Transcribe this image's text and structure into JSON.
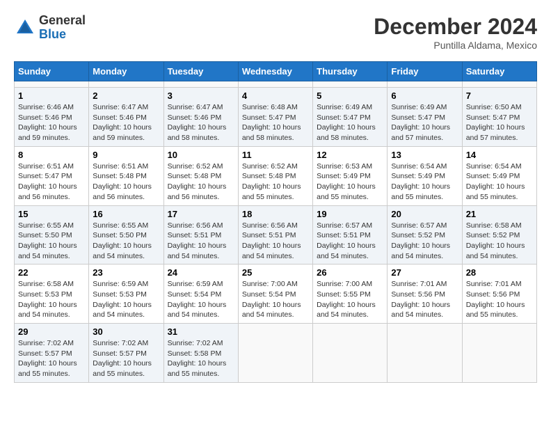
{
  "header": {
    "logo_general": "General",
    "logo_blue": "Blue",
    "month_title": "December 2024",
    "subtitle": "Puntilla Aldama, Mexico"
  },
  "calendar": {
    "columns": [
      "Sunday",
      "Monday",
      "Tuesday",
      "Wednesday",
      "Thursday",
      "Friday",
      "Saturday"
    ],
    "weeks": [
      [
        null,
        null,
        null,
        null,
        null,
        null,
        null
      ],
      [
        {
          "day": 1,
          "info": "Sunrise: 6:46 AM\nSunset: 5:46 PM\nDaylight: 10 hours\nand 59 minutes."
        },
        {
          "day": 2,
          "info": "Sunrise: 6:47 AM\nSunset: 5:46 PM\nDaylight: 10 hours\nand 59 minutes."
        },
        {
          "day": 3,
          "info": "Sunrise: 6:47 AM\nSunset: 5:46 PM\nDaylight: 10 hours\nand 58 minutes."
        },
        {
          "day": 4,
          "info": "Sunrise: 6:48 AM\nSunset: 5:47 PM\nDaylight: 10 hours\nand 58 minutes."
        },
        {
          "day": 5,
          "info": "Sunrise: 6:49 AM\nSunset: 5:47 PM\nDaylight: 10 hours\nand 58 minutes."
        },
        {
          "day": 6,
          "info": "Sunrise: 6:49 AM\nSunset: 5:47 PM\nDaylight: 10 hours\nand 57 minutes."
        },
        {
          "day": 7,
          "info": "Sunrise: 6:50 AM\nSunset: 5:47 PM\nDaylight: 10 hours\nand 57 minutes."
        }
      ],
      [
        {
          "day": 8,
          "info": "Sunrise: 6:51 AM\nSunset: 5:47 PM\nDaylight: 10 hours\nand 56 minutes."
        },
        {
          "day": 9,
          "info": "Sunrise: 6:51 AM\nSunset: 5:48 PM\nDaylight: 10 hours\nand 56 minutes."
        },
        {
          "day": 10,
          "info": "Sunrise: 6:52 AM\nSunset: 5:48 PM\nDaylight: 10 hours\nand 56 minutes."
        },
        {
          "day": 11,
          "info": "Sunrise: 6:52 AM\nSunset: 5:48 PM\nDaylight: 10 hours\nand 55 minutes."
        },
        {
          "day": 12,
          "info": "Sunrise: 6:53 AM\nSunset: 5:49 PM\nDaylight: 10 hours\nand 55 minutes."
        },
        {
          "day": 13,
          "info": "Sunrise: 6:54 AM\nSunset: 5:49 PM\nDaylight: 10 hours\nand 55 minutes."
        },
        {
          "day": 14,
          "info": "Sunrise: 6:54 AM\nSunset: 5:49 PM\nDaylight: 10 hours\nand 55 minutes."
        }
      ],
      [
        {
          "day": 15,
          "info": "Sunrise: 6:55 AM\nSunset: 5:50 PM\nDaylight: 10 hours\nand 54 minutes."
        },
        {
          "day": 16,
          "info": "Sunrise: 6:55 AM\nSunset: 5:50 PM\nDaylight: 10 hours\nand 54 minutes."
        },
        {
          "day": 17,
          "info": "Sunrise: 6:56 AM\nSunset: 5:51 PM\nDaylight: 10 hours\nand 54 minutes."
        },
        {
          "day": 18,
          "info": "Sunrise: 6:56 AM\nSunset: 5:51 PM\nDaylight: 10 hours\nand 54 minutes."
        },
        {
          "day": 19,
          "info": "Sunrise: 6:57 AM\nSunset: 5:51 PM\nDaylight: 10 hours\nand 54 minutes."
        },
        {
          "day": 20,
          "info": "Sunrise: 6:57 AM\nSunset: 5:52 PM\nDaylight: 10 hours\nand 54 minutes."
        },
        {
          "day": 21,
          "info": "Sunrise: 6:58 AM\nSunset: 5:52 PM\nDaylight: 10 hours\nand 54 minutes."
        }
      ],
      [
        {
          "day": 22,
          "info": "Sunrise: 6:58 AM\nSunset: 5:53 PM\nDaylight: 10 hours\nand 54 minutes."
        },
        {
          "day": 23,
          "info": "Sunrise: 6:59 AM\nSunset: 5:53 PM\nDaylight: 10 hours\nand 54 minutes."
        },
        {
          "day": 24,
          "info": "Sunrise: 6:59 AM\nSunset: 5:54 PM\nDaylight: 10 hours\nand 54 minutes."
        },
        {
          "day": 25,
          "info": "Sunrise: 7:00 AM\nSunset: 5:54 PM\nDaylight: 10 hours\nand 54 minutes."
        },
        {
          "day": 26,
          "info": "Sunrise: 7:00 AM\nSunset: 5:55 PM\nDaylight: 10 hours\nand 54 minutes."
        },
        {
          "day": 27,
          "info": "Sunrise: 7:01 AM\nSunset: 5:56 PM\nDaylight: 10 hours\nand 54 minutes."
        },
        {
          "day": 28,
          "info": "Sunrise: 7:01 AM\nSunset: 5:56 PM\nDaylight: 10 hours\nand 55 minutes."
        }
      ],
      [
        {
          "day": 29,
          "info": "Sunrise: 7:02 AM\nSunset: 5:57 PM\nDaylight: 10 hours\nand 55 minutes."
        },
        {
          "day": 30,
          "info": "Sunrise: 7:02 AM\nSunset: 5:57 PM\nDaylight: 10 hours\nand 55 minutes."
        },
        {
          "day": 31,
          "info": "Sunrise: 7:02 AM\nSunset: 5:58 PM\nDaylight: 10 hours\nand 55 minutes."
        },
        null,
        null,
        null,
        null
      ]
    ]
  }
}
